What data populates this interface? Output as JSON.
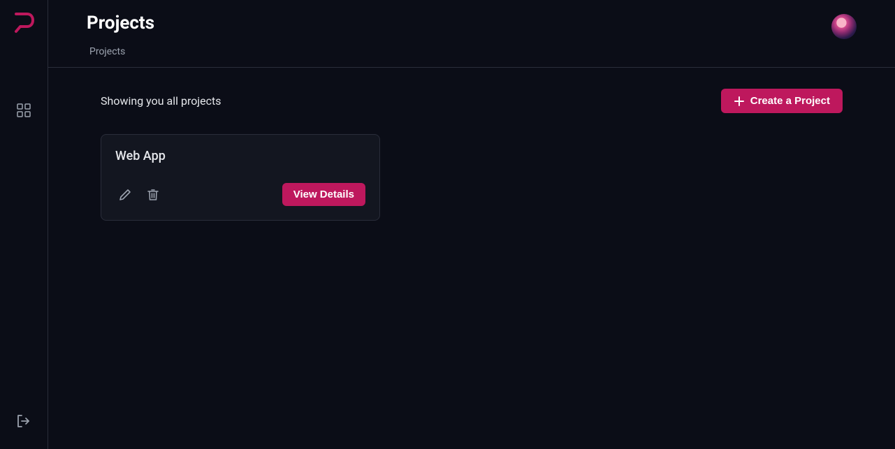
{
  "header": {
    "title": "Projects",
    "breadcrumb": "Projects"
  },
  "content": {
    "subtitle": "Showing you all projects",
    "create_label": "Create a Project"
  },
  "projects": [
    {
      "title": "Web App",
      "view_label": "View Details"
    }
  ],
  "colors": {
    "accent": "#be185d",
    "background": "#0b0d17",
    "card_bg": "#131620",
    "border": "#2a2d3a",
    "text": "#e5e7eb",
    "text_muted": "#9ca3af"
  },
  "icons": {
    "logo": "p-logo",
    "dashboard": "grid-icon",
    "logout": "logout-icon",
    "edit": "pencil-icon",
    "delete": "trash-icon",
    "plus": "plus-icon"
  }
}
